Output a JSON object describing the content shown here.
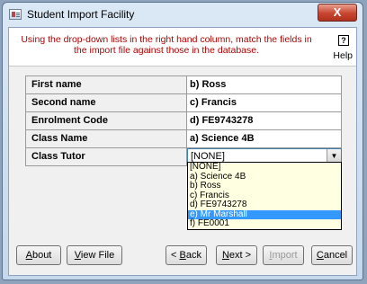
{
  "window": {
    "title": "Student Import Facility",
    "close_glyph": "X"
  },
  "header": {
    "instructions": "Using the drop-down lists in the right hand column, match the fields in the import file against those in the database.",
    "help_icon": "?",
    "help_label": "Help"
  },
  "fields": [
    {
      "label": "First name",
      "value": "b) Ross"
    },
    {
      "label": "Second name",
      "value": "c) Francis"
    },
    {
      "label": "Enrolment Code",
      "value": "d) FE9743278"
    },
    {
      "label": "Class Name",
      "value": "a) Science 4B"
    },
    {
      "label": "Class Tutor",
      "value": "[NONE]"
    }
  ],
  "dropdown": {
    "options": [
      "[NONE]",
      "a) Science 4B",
      "b) Ross",
      "c) Francis",
      "d) FE9743278",
      "e) Mr Marshall",
      "f) FE0001"
    ],
    "highlighted_index": 5
  },
  "buttons": {
    "about": {
      "mnemonic": "A",
      "rest": "bout"
    },
    "view_file": {
      "mnemonic": "V",
      "rest": "iew File"
    },
    "back": {
      "prefix": "< ",
      "mnemonic": "B",
      "rest": "ack"
    },
    "next": {
      "mnemonic": "N",
      "rest": "ext >"
    },
    "import": {
      "mnemonic": "I",
      "rest": "mport"
    },
    "cancel": {
      "mnemonic": "C",
      "rest": "ancel"
    }
  }
}
